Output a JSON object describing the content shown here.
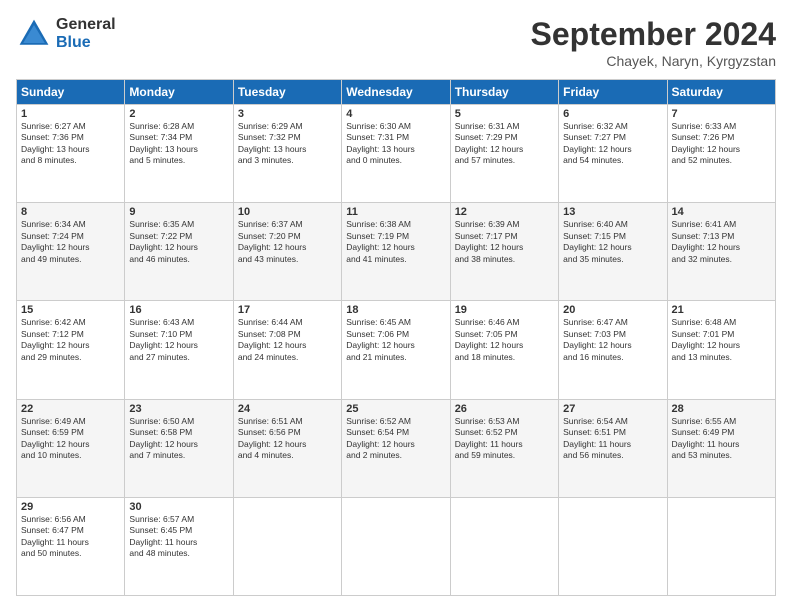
{
  "header": {
    "logo_general": "General",
    "logo_blue": "Blue",
    "title": "September 2024",
    "location": "Chayek, Naryn, Kyrgyzstan"
  },
  "weekdays": [
    "Sunday",
    "Monday",
    "Tuesday",
    "Wednesday",
    "Thursday",
    "Friday",
    "Saturday"
  ],
  "weeks": [
    [
      {
        "day": "1",
        "info": "Sunrise: 6:27 AM\nSunset: 7:36 PM\nDaylight: 13 hours\nand 8 minutes."
      },
      {
        "day": "2",
        "info": "Sunrise: 6:28 AM\nSunset: 7:34 PM\nDaylight: 13 hours\nand 5 minutes."
      },
      {
        "day": "3",
        "info": "Sunrise: 6:29 AM\nSunset: 7:32 PM\nDaylight: 13 hours\nand 3 minutes."
      },
      {
        "day": "4",
        "info": "Sunrise: 6:30 AM\nSunset: 7:31 PM\nDaylight: 13 hours\nand 0 minutes."
      },
      {
        "day": "5",
        "info": "Sunrise: 6:31 AM\nSunset: 7:29 PM\nDaylight: 12 hours\nand 57 minutes."
      },
      {
        "day": "6",
        "info": "Sunrise: 6:32 AM\nSunset: 7:27 PM\nDaylight: 12 hours\nand 54 minutes."
      },
      {
        "day": "7",
        "info": "Sunrise: 6:33 AM\nSunset: 7:26 PM\nDaylight: 12 hours\nand 52 minutes."
      }
    ],
    [
      {
        "day": "8",
        "info": "Sunrise: 6:34 AM\nSunset: 7:24 PM\nDaylight: 12 hours\nand 49 minutes."
      },
      {
        "day": "9",
        "info": "Sunrise: 6:35 AM\nSunset: 7:22 PM\nDaylight: 12 hours\nand 46 minutes."
      },
      {
        "day": "10",
        "info": "Sunrise: 6:37 AM\nSunset: 7:20 PM\nDaylight: 12 hours\nand 43 minutes."
      },
      {
        "day": "11",
        "info": "Sunrise: 6:38 AM\nSunset: 7:19 PM\nDaylight: 12 hours\nand 41 minutes."
      },
      {
        "day": "12",
        "info": "Sunrise: 6:39 AM\nSunset: 7:17 PM\nDaylight: 12 hours\nand 38 minutes."
      },
      {
        "day": "13",
        "info": "Sunrise: 6:40 AM\nSunset: 7:15 PM\nDaylight: 12 hours\nand 35 minutes."
      },
      {
        "day": "14",
        "info": "Sunrise: 6:41 AM\nSunset: 7:13 PM\nDaylight: 12 hours\nand 32 minutes."
      }
    ],
    [
      {
        "day": "15",
        "info": "Sunrise: 6:42 AM\nSunset: 7:12 PM\nDaylight: 12 hours\nand 29 minutes."
      },
      {
        "day": "16",
        "info": "Sunrise: 6:43 AM\nSunset: 7:10 PM\nDaylight: 12 hours\nand 27 minutes."
      },
      {
        "day": "17",
        "info": "Sunrise: 6:44 AM\nSunset: 7:08 PM\nDaylight: 12 hours\nand 24 minutes."
      },
      {
        "day": "18",
        "info": "Sunrise: 6:45 AM\nSunset: 7:06 PM\nDaylight: 12 hours\nand 21 minutes."
      },
      {
        "day": "19",
        "info": "Sunrise: 6:46 AM\nSunset: 7:05 PM\nDaylight: 12 hours\nand 18 minutes."
      },
      {
        "day": "20",
        "info": "Sunrise: 6:47 AM\nSunset: 7:03 PM\nDaylight: 12 hours\nand 16 minutes."
      },
      {
        "day": "21",
        "info": "Sunrise: 6:48 AM\nSunset: 7:01 PM\nDaylight: 12 hours\nand 13 minutes."
      }
    ],
    [
      {
        "day": "22",
        "info": "Sunrise: 6:49 AM\nSunset: 6:59 PM\nDaylight: 12 hours\nand 10 minutes."
      },
      {
        "day": "23",
        "info": "Sunrise: 6:50 AM\nSunset: 6:58 PM\nDaylight: 12 hours\nand 7 minutes."
      },
      {
        "day": "24",
        "info": "Sunrise: 6:51 AM\nSunset: 6:56 PM\nDaylight: 12 hours\nand 4 minutes."
      },
      {
        "day": "25",
        "info": "Sunrise: 6:52 AM\nSunset: 6:54 PM\nDaylight: 12 hours\nand 2 minutes."
      },
      {
        "day": "26",
        "info": "Sunrise: 6:53 AM\nSunset: 6:52 PM\nDaylight: 11 hours\nand 59 minutes."
      },
      {
        "day": "27",
        "info": "Sunrise: 6:54 AM\nSunset: 6:51 PM\nDaylight: 11 hours\nand 56 minutes."
      },
      {
        "day": "28",
        "info": "Sunrise: 6:55 AM\nSunset: 6:49 PM\nDaylight: 11 hours\nand 53 minutes."
      }
    ],
    [
      {
        "day": "29",
        "info": "Sunrise: 6:56 AM\nSunset: 6:47 PM\nDaylight: 11 hours\nand 50 minutes."
      },
      {
        "day": "30",
        "info": "Sunrise: 6:57 AM\nSunset: 6:45 PM\nDaylight: 11 hours\nand 48 minutes."
      },
      null,
      null,
      null,
      null,
      null
    ]
  ]
}
